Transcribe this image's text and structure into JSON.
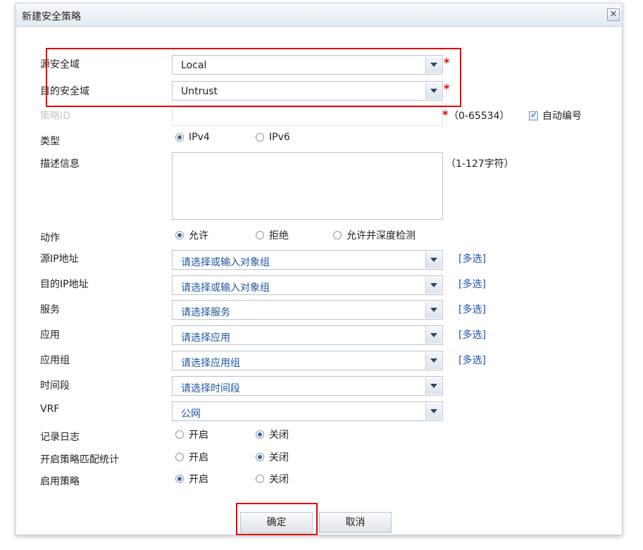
{
  "dialog": {
    "title": "新建安全策略",
    "close_glyph": "✕"
  },
  "form": {
    "src_zone": {
      "label": "源安全域",
      "value": "Local"
    },
    "dst_zone": {
      "label": "目的安全域",
      "value": "Untrust"
    },
    "required_mark": "*",
    "policy_id": {
      "label": "策略ID",
      "value": "",
      "range_hint": "（0-65534）",
      "auto_number_label": "自动编号",
      "auto_number_checked": true
    },
    "type": {
      "label": "类型",
      "options": [
        "IPv4",
        "IPv6"
      ],
      "selected": "IPv4"
    },
    "description": {
      "label": "描述信息",
      "value": "",
      "hint": "（1-127字符）"
    },
    "action": {
      "label": "动作",
      "options": [
        "允许",
        "拒绝",
        "允许并深度检测"
      ],
      "selected": "允许"
    },
    "src_ip": {
      "label": "源IP地址",
      "placeholder": "请选择或输入对象组"
    },
    "dst_ip": {
      "label": "目的IP地址",
      "placeholder": "请选择或输入对象组"
    },
    "service": {
      "label": "服务",
      "placeholder": "请选择服务"
    },
    "application": {
      "label": "应用",
      "placeholder": "请选择应用"
    },
    "app_group": {
      "label": "应用组",
      "placeholder": "请选择应用组"
    },
    "time_range": {
      "label": "时间段",
      "placeholder": "请选择时间段"
    },
    "vrf": {
      "label": "VRF",
      "value": "公网"
    },
    "multi_select_label": "[多选]",
    "logging": {
      "label": "记录日志",
      "options": [
        "开启",
        "关闭"
      ],
      "selected": "关闭"
    },
    "match_stats": {
      "label": "开启策略匹配统计",
      "options": [
        "开启",
        "关闭"
      ],
      "selected": "关闭"
    },
    "enable_policy": {
      "label": "启用策略",
      "options": [
        "开启",
        "关闭"
      ],
      "selected": "开启"
    }
  },
  "buttons": {
    "ok": "确定",
    "cancel": "取消"
  },
  "colors": {
    "highlight": "#e00000",
    "link": "#1f4fb5",
    "placeholder": "#1f55a4"
  }
}
